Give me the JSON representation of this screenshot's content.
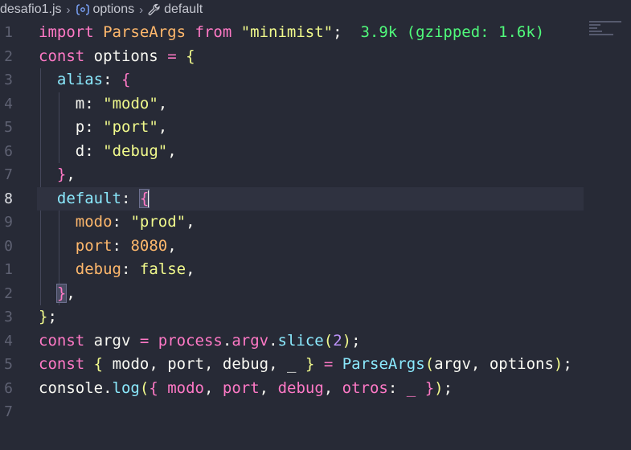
{
  "breadcrumb": {
    "file": "desafio1.js",
    "symbol": "options",
    "property": "default"
  },
  "line_numbers": [
    "1",
    "2",
    "3",
    "4",
    "5",
    "6",
    "7",
    "8",
    "9",
    "0",
    "1",
    "2",
    "3",
    "4",
    "5",
    "6",
    "7"
  ],
  "active_line": 8,
  "import_size_hint": "3.9k (gzipped: 1.6k)",
  "code": {
    "l1": {
      "kw": "import",
      "name": "ParseArgs",
      "from": "from",
      "module": "\"minimist\"",
      "semi": ";"
    },
    "l2": {
      "kw": "const",
      "name": "options",
      "eq": "=",
      "brace": "{"
    },
    "l3": {
      "key": "alias",
      "colon": ":",
      "brace": "{"
    },
    "l4": {
      "key": "m",
      "colon": ":",
      "value": "\"modo\"",
      "comma": ","
    },
    "l5": {
      "key": "p",
      "colon": ":",
      "value": "\"port\"",
      "comma": ","
    },
    "l6": {
      "key": "d",
      "colon": ":",
      "value": "\"debug\"",
      "comma": ","
    },
    "l7": {
      "brace": "}",
      "comma": ","
    },
    "l8": {
      "key": "default",
      "colon": ":",
      "brace": "{"
    },
    "l9": {
      "key": "modo",
      "colon": ":",
      "value": "\"prod\"",
      "comma": ","
    },
    "l10": {
      "key": "port",
      "colon": ":",
      "value": "8080",
      "comma": ","
    },
    "l11": {
      "key": "debug",
      "colon": ":",
      "value": "false",
      "comma": ","
    },
    "l12": {
      "brace": "}",
      "comma": ","
    },
    "l13": {
      "brace": "}",
      "semi": ";"
    },
    "l14": {
      "kw": "const",
      "name": "argv",
      "eq": "=",
      "obj": "process",
      "dot1": ".",
      "prop1": "argv",
      "dot2": ".",
      "method": "slice",
      "open": "(",
      "arg": "2",
      "close": ")",
      "semi": ";"
    },
    "l15": {
      "kw": "const",
      "open": "{",
      "a": "modo",
      "c1": ",",
      "b": "port",
      "c2": ",",
      "c": "debug",
      "c3": ",",
      "d": "_",
      "close": "}",
      "eq": "=",
      "fn": "ParseArgs",
      "popen": "(",
      "arg1": "argv",
      "c4": ",",
      "arg2": "options",
      "pclose": ")",
      "semi": ";"
    },
    "l16": {
      "obj": "console",
      "dot": ".",
      "method": "log",
      "popen": "(",
      "open": "{",
      "a": "modo",
      "c1": ",",
      "b": "port",
      "c2": ",",
      "c": "debug",
      "c3": ",",
      "key": "otros",
      "colon": ":",
      "d": "_",
      "close": "}",
      "pclose": ")",
      "semi": ";"
    }
  },
  "colors": {
    "background": "#272a36",
    "keyword": "#ff79c6",
    "string": "#f1fa8c",
    "number": "#bd93f9",
    "function": "#50fa7b",
    "property": "#8be9fd",
    "parameter": "#ffb86c"
  }
}
